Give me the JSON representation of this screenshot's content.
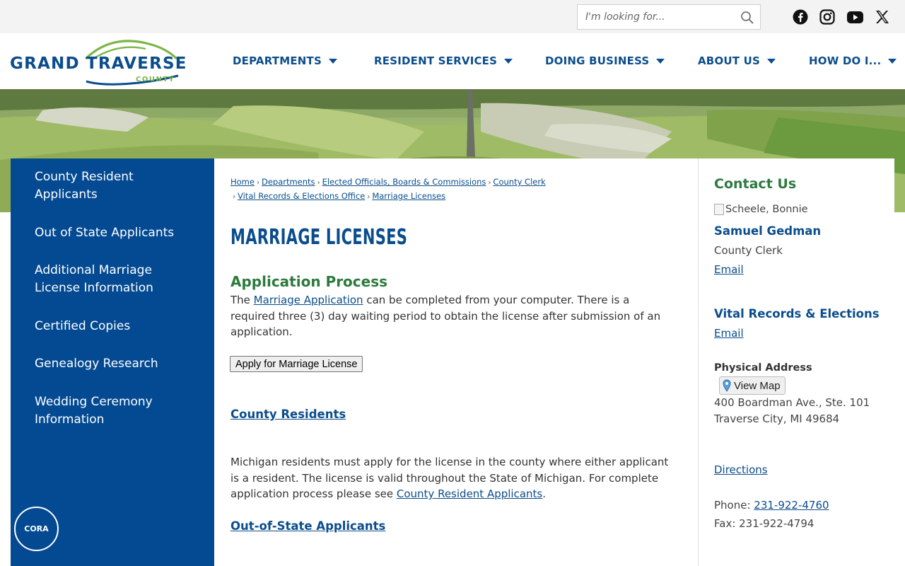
{
  "search": {
    "placeholder": "I'm looking for..."
  },
  "logo": {
    "main": "GRAND TRAVERSE",
    "sub": "COUNTY"
  },
  "nav": [
    {
      "label": "DEPARTMENTS"
    },
    {
      "label": "RESIDENT SERVICES"
    },
    {
      "label": "DOING BUSINESS"
    },
    {
      "label": "ABOUT US"
    },
    {
      "label": "HOW DO I..."
    }
  ],
  "sidebar": {
    "items": [
      {
        "label": "County Resident Applicants"
      },
      {
        "label": "Out of State Applicants"
      },
      {
        "label": "Additional Marriage License Information"
      },
      {
        "label": "Certified Copies"
      },
      {
        "label": "Genealogy Research"
      },
      {
        "label": "Wedding Ceremony Information"
      }
    ]
  },
  "breadcrumb": {
    "items": [
      "Home",
      "Departments",
      "Elected Officials, Boards & Commissions",
      "County Clerk",
      "Vital Records & Elections Office",
      "Marriage Licenses"
    ]
  },
  "main": {
    "title": "MARRIAGE LICENSES",
    "section1_heading": "Application Process",
    "section1_pre": "The ",
    "section1_link": "Marriage Application",
    "section1_post": " can be completed from your computer. There is a required three (3) day waiting period to obtain the license after submission of an application.",
    "apply_button": "Apply for Marriage License",
    "county_residents_link": "County Residents",
    "residents_text": "Michigan residents must apply for the license in the county where either applicant is a resident. The license is valid throughout the State of Michigan.  For complete application process please see ",
    "residents_link": "County Resident Applicants",
    "residents_end": ".",
    "out_of_state_link": "Out-of-State Applicants"
  },
  "contact": {
    "heading": "Contact Us",
    "image_alt": "Scheele, Bonnie",
    "name": "Samuel Gedman",
    "role": "County Clerk",
    "email1": "Email",
    "office": "Vital Records & Elections",
    "email2": "Email",
    "address_label": "Physical Address",
    "map_button": "View Map",
    "address_line1": "400 Boardman Ave., Ste. 101",
    "address_line2": "Traverse City, MI 49684",
    "directions": "Directions",
    "phone_label": "Phone: ",
    "phone": "231-922-4760",
    "fax": "Fax: 231-922-4794"
  },
  "chat": {
    "label": "CORA"
  },
  "colors": {
    "brand_blue": "#0b4d8c",
    "sidebar_blue": "#034a92",
    "heading_green": "#2c7a3e",
    "logo_green": "#7ab648"
  }
}
